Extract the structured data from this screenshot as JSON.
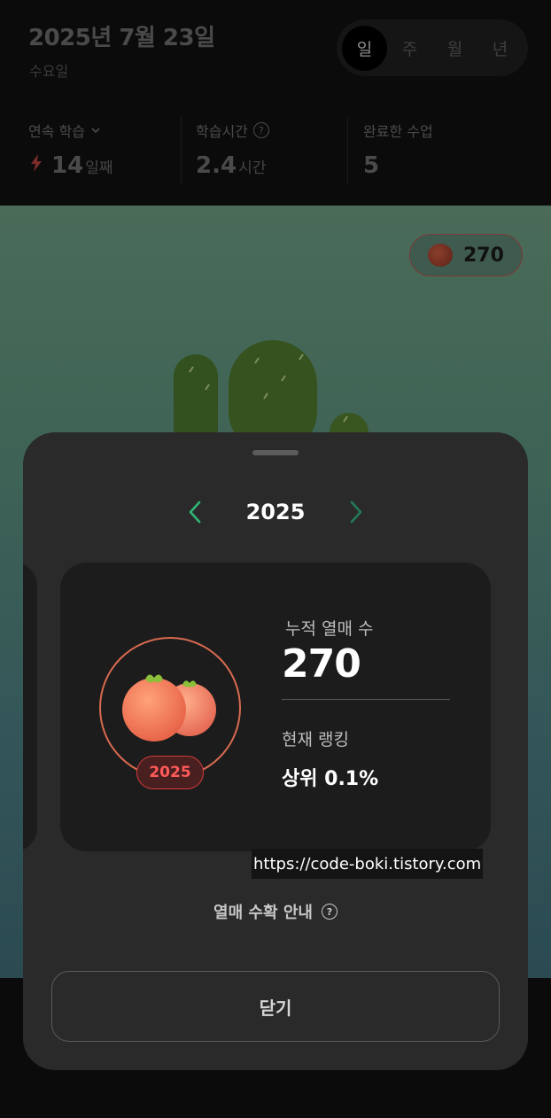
{
  "header": {
    "date": "2025년 7월 23일",
    "weekday": "수요일",
    "periods": [
      "일",
      "주",
      "월",
      "년"
    ],
    "active_period": "일",
    "stats": {
      "streak": {
        "label": "연속 학습",
        "value": "14",
        "unit": "일째"
      },
      "study_time": {
        "label": "학습시간",
        "value": "2.4",
        "unit": "시간"
      },
      "completed": {
        "label": "완료한 수업",
        "value": "5"
      }
    }
  },
  "garden": {
    "fruit_count": "270"
  },
  "sheet": {
    "year": "2025",
    "card": {
      "badge_year": "2025",
      "total_label": "누적 열매 수",
      "total_value": "270",
      "rank_label": "현재 랭킹",
      "rank_value": "상위 0.1%"
    },
    "watermark": "https://code-boki.tistory.com",
    "guide_label": "열매 수확 안내",
    "close_label": "닫기"
  },
  "colors": {
    "accent_green": "#2fb57a",
    "badge_red": "#ff5a5a",
    "sheet_bg": "#2a2a2a",
    "card_bg": "#1c1c1c"
  },
  "icons": [
    "lightning-icon",
    "chevron-down-icon",
    "question-icon",
    "chevron-left-icon",
    "chevron-right-icon",
    "fruit-icon"
  ]
}
